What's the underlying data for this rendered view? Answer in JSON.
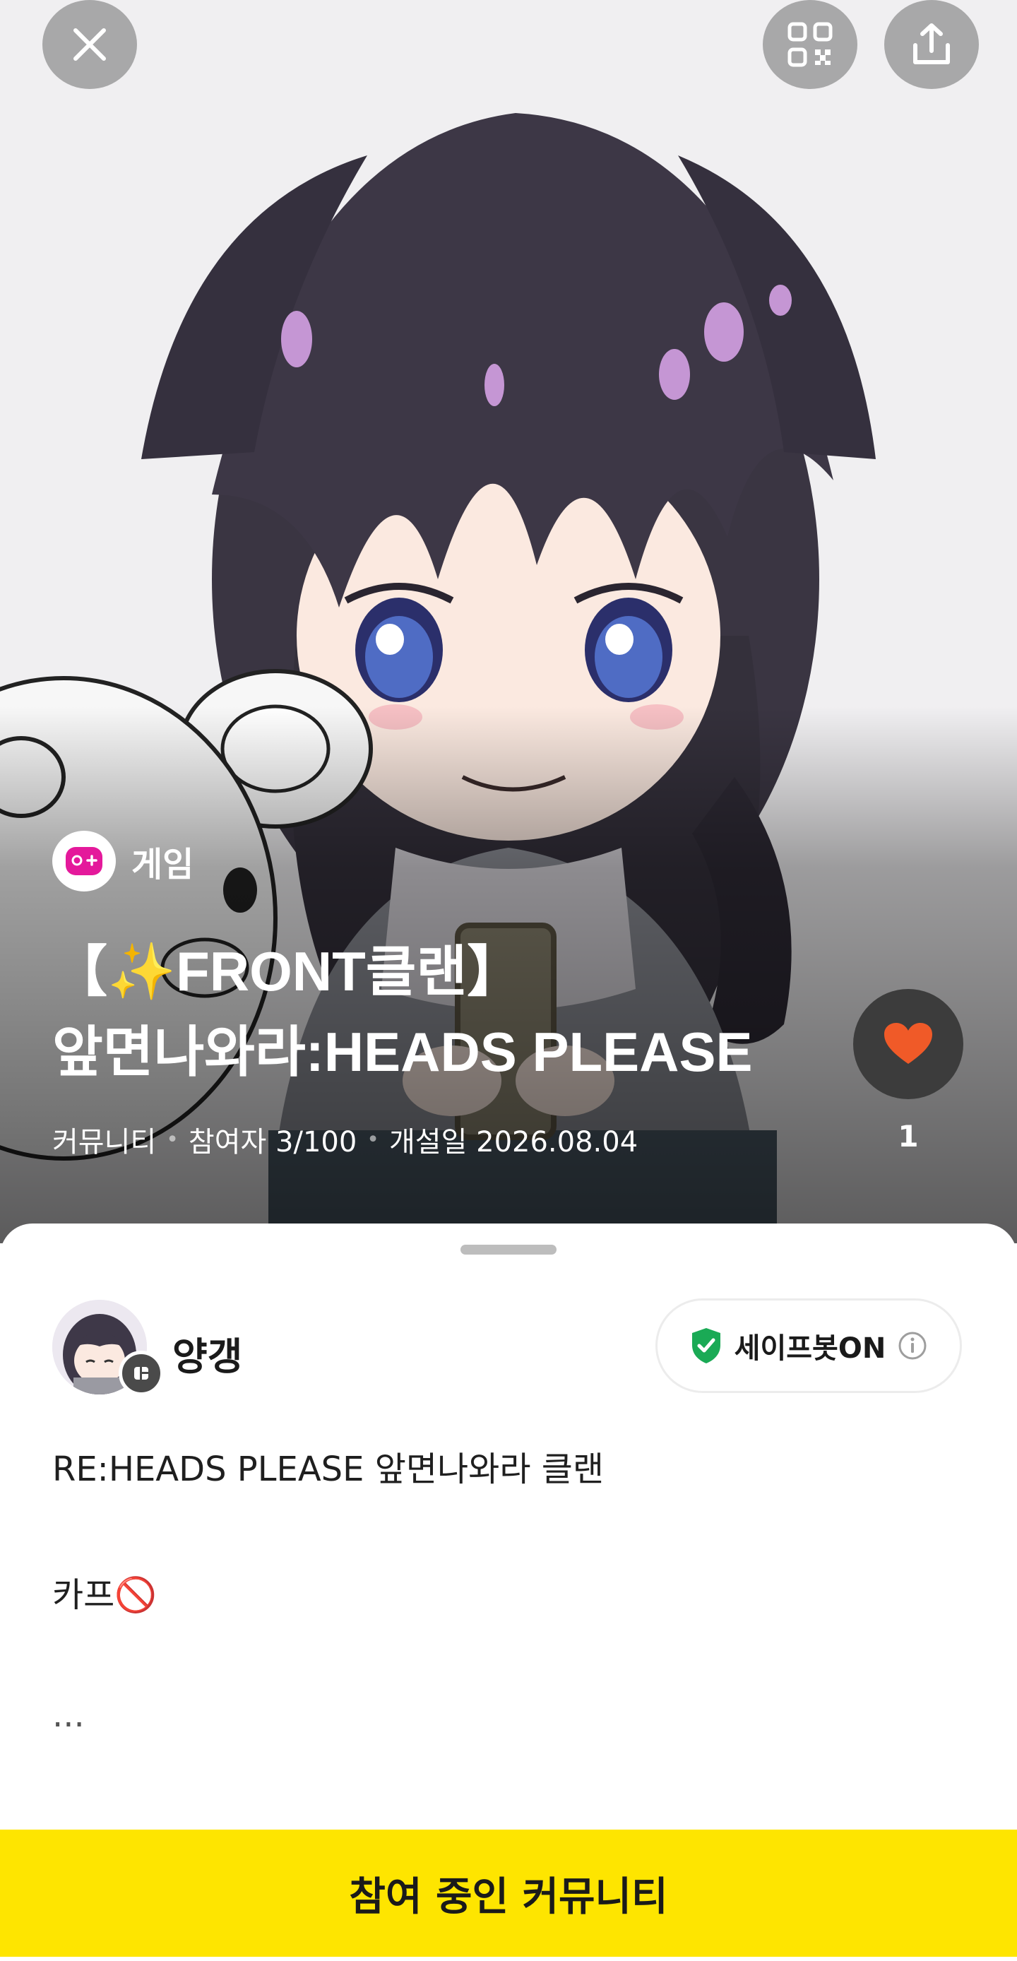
{
  "header": {
    "close_icon": "close-icon",
    "qr_icon": "qr-code-icon",
    "share_icon": "share-icon"
  },
  "community": {
    "category_icon": "game-controller-icon",
    "category_label": "게임",
    "title_line1": "【✨FRONT클랜】",
    "title_line2": "앞면나와라:HEADS PLEASE",
    "meta": {
      "type": "커뮤니티",
      "participants": "참여자 3/100",
      "opened": "개설일 2026.08.04"
    },
    "like_icon": "heart-icon",
    "like_count": "1",
    "like_color": "#f05a28"
  },
  "owner": {
    "name": "양갱",
    "safebot_label": "세이프봇ON",
    "safebot_icon": "shield-check-icon",
    "info_icon": "info-icon"
  },
  "description": {
    "line1": "RE:HEADS PLEASE 앞면나와라 클랜",
    "line2": "카프🚫",
    "more": "..."
  },
  "cta": {
    "label": "참여 중인 커뮤니티",
    "color": "#fee500"
  }
}
